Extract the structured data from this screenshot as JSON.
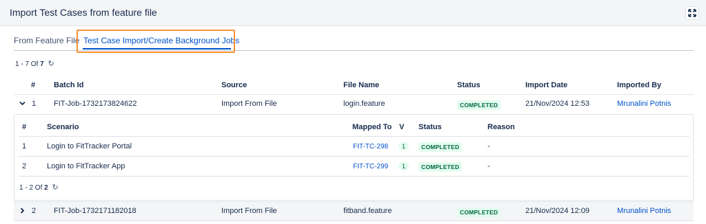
{
  "dialog": {
    "title": "Import Test Cases from feature file",
    "expand_icon": "expand-arrows-icon"
  },
  "tabs": [
    {
      "label": "From Feature File",
      "active": false
    },
    {
      "label": "Test Case Import/Create Background Jobs",
      "active": true
    }
  ],
  "pager_top": {
    "range": "1 - 7",
    "of_label": "Of",
    "total": "7"
  },
  "jobs_table": {
    "columns": [
      "#",
      "Batch Id",
      "Source",
      "File Name",
      "Status",
      "Import Date",
      "Imported By"
    ],
    "rows": [
      {
        "index": "1",
        "batch_id": "FIT-Job-1732173824622",
        "source": "Import From File",
        "file_name": "login.feature",
        "status": "COMPLETED",
        "import_date": "21/Nov/2024 12:53",
        "imported_by": "Mrunalini Potnis",
        "expanded": true
      },
      {
        "index": "2",
        "batch_id": "FIT-Job-1732171182018",
        "source": "Import From File",
        "file_name": "fitband.feature",
        "status": "COMPLETED",
        "import_date": "21/Nov/2024 12:09",
        "imported_by": "Mrunalini Potnis",
        "expanded": false
      }
    ]
  },
  "scenario_table": {
    "columns": [
      "#",
      "Scenario",
      "Mapped To",
      "V",
      "Status",
      "Reason"
    ],
    "rows": [
      {
        "index": "1",
        "scenario": "Login to FitTracker Portal",
        "mapped_to": "FIT-TC-298",
        "version": "1",
        "status": "COMPLETED",
        "reason": "-"
      },
      {
        "index": "2",
        "scenario": "Login to FitTracker App",
        "mapped_to": "FIT-TC-299",
        "version": "1",
        "status": "COMPLETED",
        "reason": "-"
      }
    ]
  },
  "pager_inner": {
    "range": "1 - 2",
    "of_label": "Of",
    "total": "2"
  },
  "colors": {
    "accent": "#0052cc",
    "highlight": "#f79232",
    "success_bg": "#e3fcef",
    "success_text": "#006644"
  }
}
